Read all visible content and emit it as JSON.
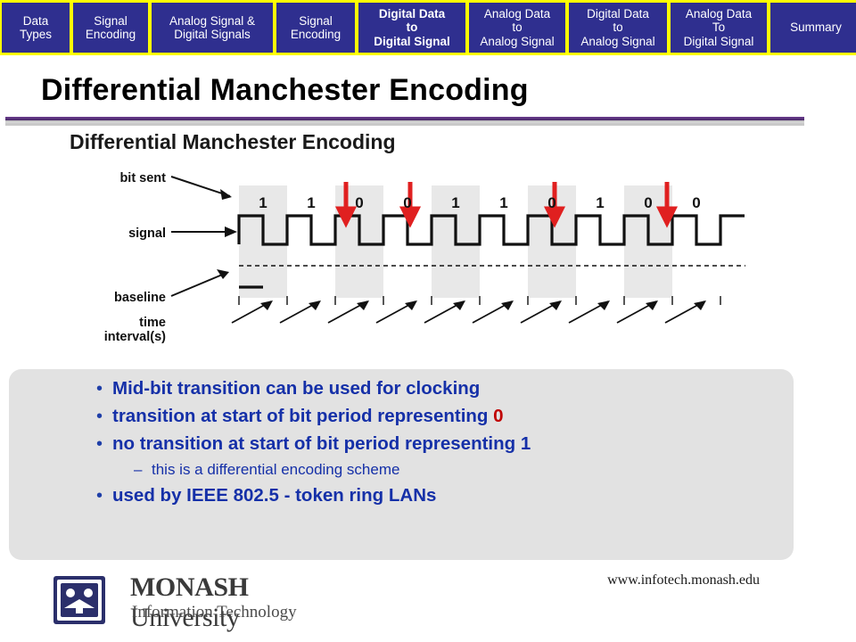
{
  "navbar": {
    "items": [
      {
        "label": "Data Types",
        "lines": [
          "Data",
          "Types"
        ],
        "active": false,
        "width_class": "nav-w1"
      },
      {
        "label": "Signal Encoding",
        "lines": [
          "Signal",
          "Encoding"
        ],
        "active": false,
        "width_class": "nav-w2"
      },
      {
        "label": "Analog Signal & Digital Signals",
        "lines": [
          "Analog Signal &",
          "Digital Signals"
        ],
        "active": false,
        "width_class": "nav-w3"
      },
      {
        "label": "Signal Encoding",
        "lines": [
          "Signal",
          "Encoding"
        ],
        "active": false,
        "width_class": "nav-w4"
      },
      {
        "label": "Digital Data to Digital Signal",
        "lines": [
          "Digital Data",
          "to",
          "Digital Signal"
        ],
        "active": true,
        "width_class": "nav-w5"
      },
      {
        "label": "Analog Data to Analog Signal",
        "lines": [
          "Analog Data",
          "to",
          "Analog Signal"
        ],
        "active": false,
        "width_class": "nav-w6"
      },
      {
        "label": "Digital Data to Analog Signal",
        "lines": [
          "Digital Data",
          "to",
          "Analog Signal"
        ],
        "active": false,
        "width_class": "nav-w7"
      },
      {
        "label": "Analog Data To Digital Signal",
        "lines": [
          "Analog Data",
          "To",
          "Digital Signal"
        ],
        "active": false,
        "width_class": "nav-w8"
      },
      {
        "label": "Summary",
        "lines": [
          "Summary"
        ],
        "active": false,
        "width_class": "nav-w9"
      }
    ]
  },
  "slide": {
    "title": "Differential Manchester Encoding"
  },
  "figure": {
    "title": "Differential Manchester Encoding",
    "labels": {
      "bit_sent": "bit sent",
      "signal": "signal",
      "baseline": "baseline",
      "time_line1": "time",
      "time_line2": "interval(s)"
    },
    "bits": [
      "1",
      "1",
      "0",
      "0",
      "1",
      "1",
      "0",
      "1",
      "0",
      "0"
    ]
  },
  "bullets": [
    {
      "text_before": "Mid-bit transition can be used for clocking",
      "highlight": "",
      "text_after": ""
    },
    {
      "text_before": "transition at start of bit period representing  ",
      "highlight": "0",
      "text_after": ""
    },
    {
      "text_before": "no transition at start of bit period representing 1",
      "highlight": "",
      "text_after": ""
    }
  ],
  "sub_bullet": {
    "dash": "–",
    "text": "this is a differential encoding scheme"
  },
  "bullet_last": {
    "text": "used by IEEE 802.5  - token ring LANs"
  },
  "footer": {
    "url": "www.infotech.monash.edu",
    "logo_main_bold": "MONASH",
    "logo_main_rest": " University",
    "logo_sub": "Information Technology"
  },
  "colors": {
    "nav_bar_bg": "#ffff00",
    "nav_item_bg": "#2f2f8f",
    "bullet_blue": "#1530a8",
    "bullet_red": "#c00000",
    "panel_bg": "#e2e2e2",
    "arrow_red": "#e02020"
  }
}
